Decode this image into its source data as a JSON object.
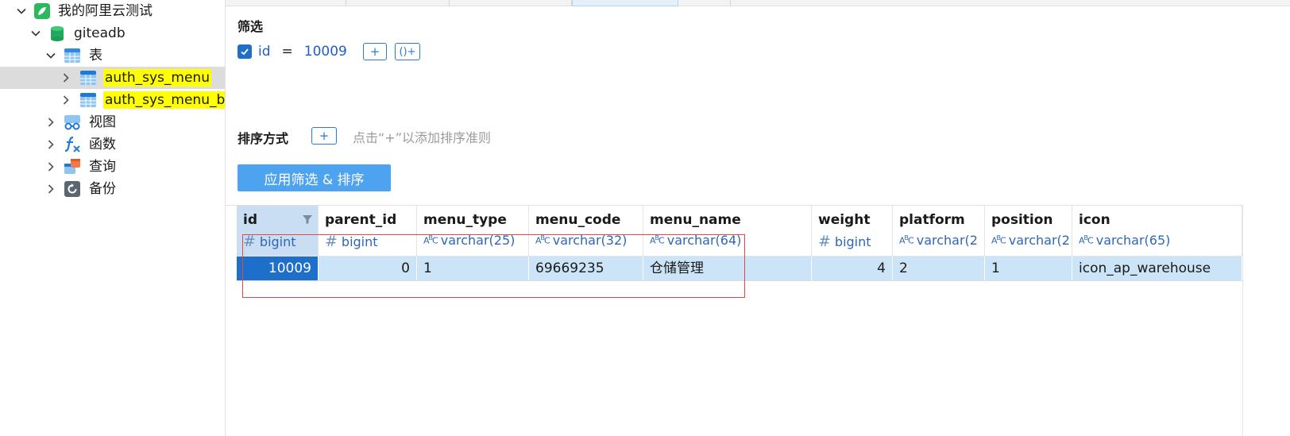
{
  "sidebar": {
    "items": [
      {
        "label": "我的阿里云测试",
        "icon": "connection-icon",
        "expanded": true
      },
      {
        "label": "giteadb",
        "icon": "database-icon",
        "expanded": true
      },
      {
        "label": "表",
        "icon": "tables-folder-icon",
        "expanded": true
      },
      {
        "label": "auth_sys_menu",
        "icon": "table-icon",
        "highlight": true,
        "selected": true
      },
      {
        "label": "auth_sys_menu_ba",
        "icon": "table-icon",
        "highlight": true
      },
      {
        "label": "视图",
        "icon": "views-icon"
      },
      {
        "label": "函数",
        "icon": "function-icon"
      },
      {
        "label": "查询",
        "icon": "query-icon"
      },
      {
        "label": "备份",
        "icon": "backup-icon"
      }
    ]
  },
  "filter": {
    "title": "筛选",
    "condition": {
      "field": "id",
      "operator": "=",
      "value": "10009",
      "checked": true
    },
    "add_label": "+",
    "add_group_label": "()+"
  },
  "sort": {
    "title": "排序方式",
    "add_label": "+",
    "hint": "点击“+”以添加排序准则"
  },
  "apply_button": "应用筛选 & 排序",
  "grid": {
    "columns": [
      {
        "name": "id",
        "type": "bigint",
        "kind": "num"
      },
      {
        "name": "parent_id",
        "type": "bigint",
        "kind": "num"
      },
      {
        "name": "menu_type",
        "type": "varchar(25)",
        "kind": "text"
      },
      {
        "name": "menu_code",
        "type": "varchar(32)",
        "kind": "text"
      },
      {
        "name": "menu_name",
        "type": "varchar(64)",
        "kind": "text"
      },
      {
        "name": "weight",
        "type": "bigint",
        "kind": "num"
      },
      {
        "name": "platform",
        "type": "varchar(2",
        "kind": "text"
      },
      {
        "name": "position",
        "type": "varchar(2",
        "kind": "text"
      },
      {
        "name": "icon",
        "type": "varchar(65)",
        "kind": "text"
      }
    ],
    "rows": [
      [
        "10009",
        "0",
        "1",
        "69669235",
        "仓储管理",
        "4",
        "2",
        "1",
        "icon_ap_warehouse"
      ]
    ]
  },
  "colors": {
    "accent": "#1e6fc9",
    "selected_row": "#cce4f7",
    "highlight": "#ffff00",
    "annotation": "#e04848",
    "apply_button": "#4da3f0"
  }
}
